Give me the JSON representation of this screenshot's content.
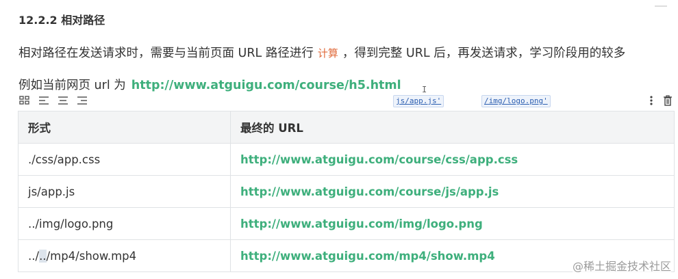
{
  "heading": "12.2.2 相对路径",
  "paragraph": {
    "before": "相对路径在发送请求时，需要与当前页面 URL 路径进行",
    "highlight": "计算",
    "after": "，得到完整 URL 后，再发送请求，学习阶段用的较多"
  },
  "example": {
    "prefix": "例如当前网页 url 为",
    "url": "http://www.atguigu.com/course/h5.html"
  },
  "floating_chips": [
    "js/app.js'",
    "/img/logo.png'"
  ],
  "cursor_glyph": "I",
  "table": {
    "headers": [
      "形式",
      "最终的 URL"
    ],
    "rows": [
      {
        "form_pre": "./css/app.css",
        "form_sel": "",
        "form_post": "",
        "url": "http://www.atguigu.com/course/css/app.css"
      },
      {
        "form_pre": "js/app.js",
        "form_sel": "",
        "form_post": "",
        "url": "http://www.atguigu.com/course/js/app.js"
      },
      {
        "form_pre": "../img/logo.png",
        "form_sel": "",
        "form_post": "",
        "url": "http://www.atguigu.com/img/logo.png"
      },
      {
        "form_pre": "../",
        "form_sel": "..",
        "form_post": "/mp4/show.mp4",
        "url": "http://www.atguigu.com/mp4/show.mp4"
      }
    ]
  },
  "watermark": "@稀土掘金技术社区",
  "colors": {
    "link_green": "#3eaf7c",
    "highlight_orange": "#e06b3c",
    "table_header_bg": "#f3f4f5"
  }
}
